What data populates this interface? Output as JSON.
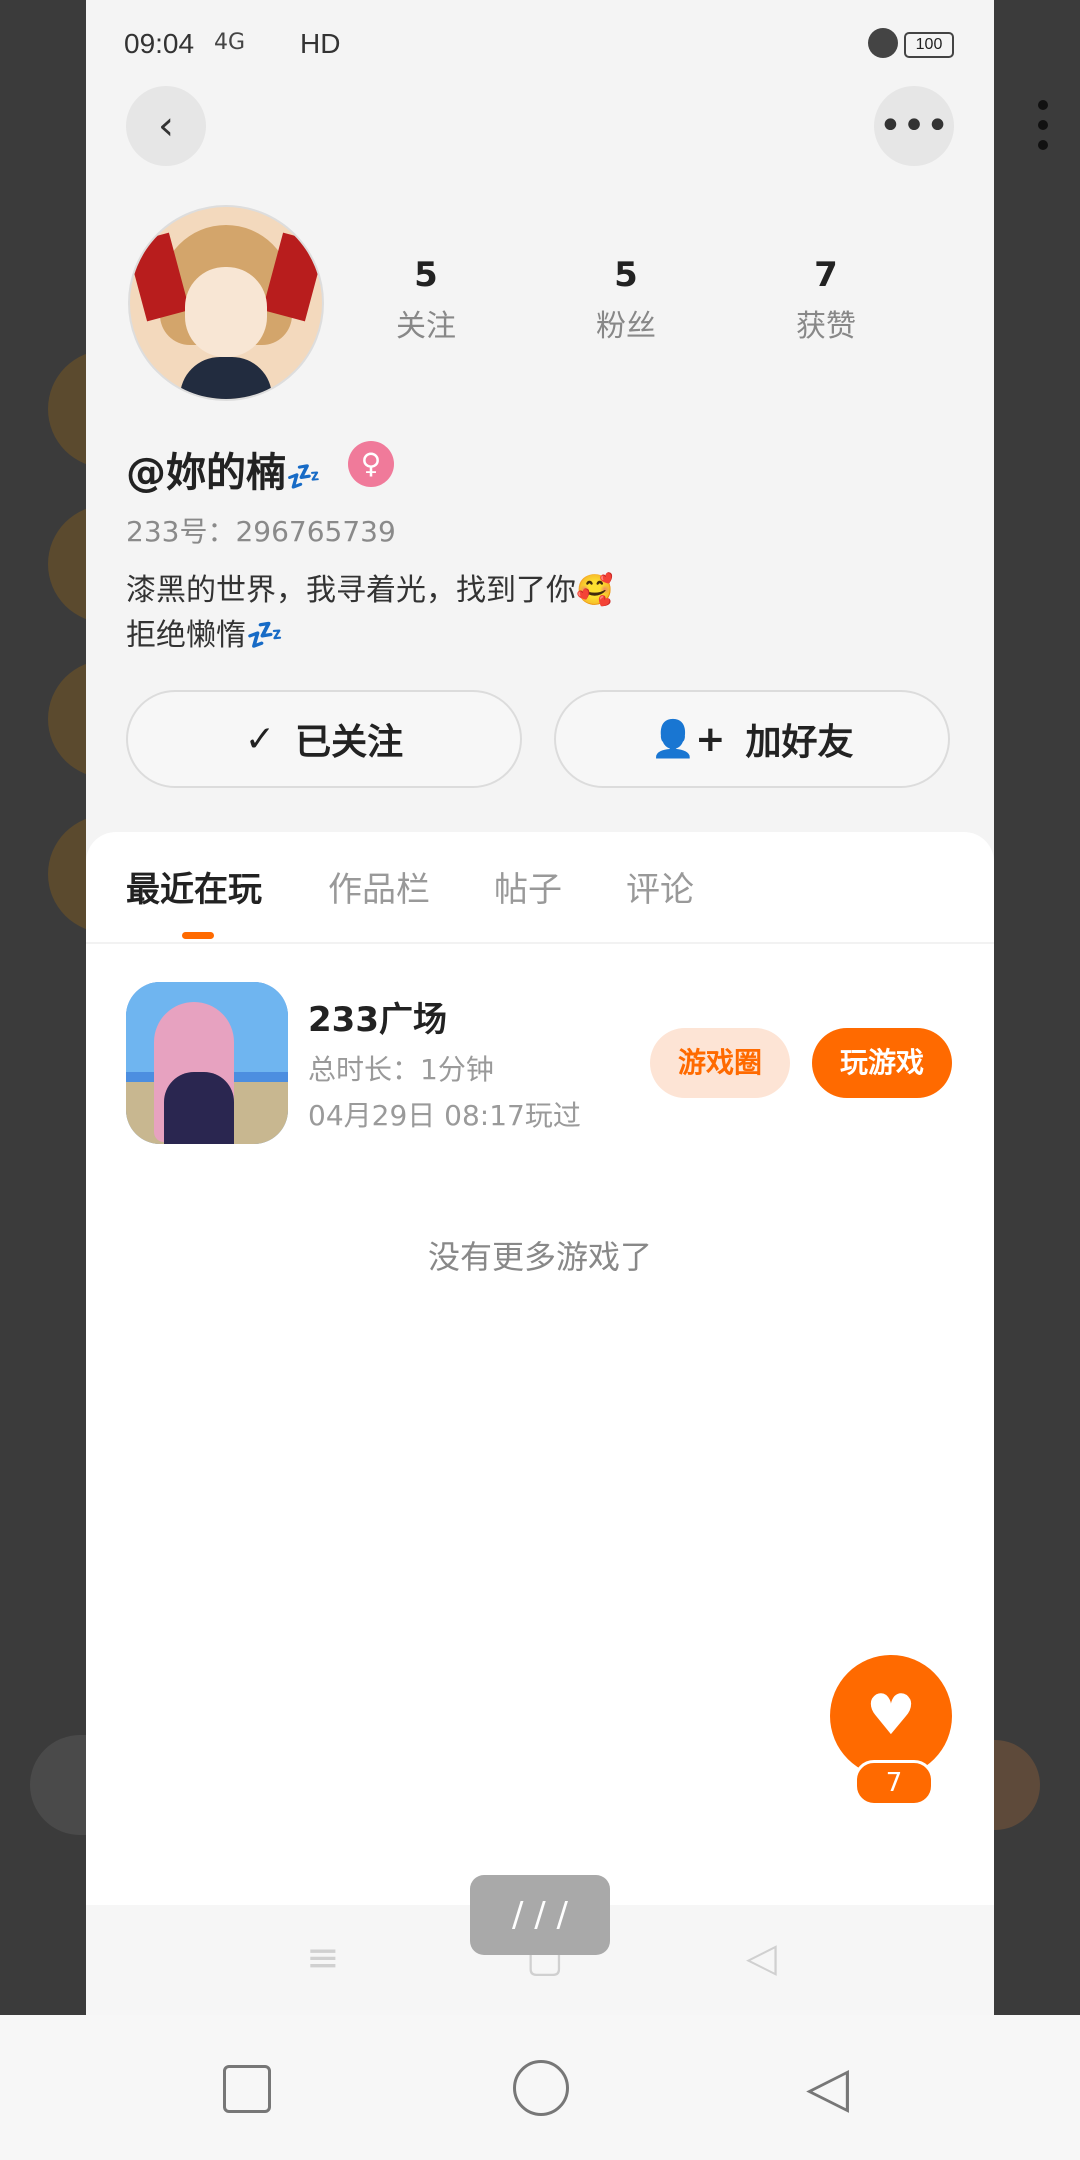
{
  "status_bar": {
    "time": "09:04",
    "network": "4G",
    "hd": "HD",
    "battery": "100"
  },
  "header": {
    "back_icon": "chevron-left-icon",
    "more_icon": "more-horizontal-icon"
  },
  "profile": {
    "stats": [
      {
        "value": "5",
        "label": "关注"
      },
      {
        "value": "5",
        "label": "粉丝"
      },
      {
        "value": "7",
        "label": "获赞"
      }
    ],
    "nickname": "@妳的楠",
    "nickname_emoji": "💤",
    "gender_symbol": "♀",
    "uid": "233号：296765739",
    "bio_line1": "漆黑的世界，我寻着光，找到了你🥰",
    "bio_line2": "拒绝懒惰💤"
  },
  "actions": {
    "follow_icon": "✓",
    "follow_label": "已关注",
    "add_friend_icon": "👤+",
    "add_friend_label": "加好友"
  },
  "tabs": [
    {
      "label": "最近在玩",
      "active": true
    },
    {
      "label": "作品栏",
      "active": false
    },
    {
      "label": "帖子",
      "active": false
    },
    {
      "label": "评论",
      "active": false
    }
  ],
  "games": [
    {
      "title": "233广场",
      "duration": "总时长：1分钟",
      "last_played": "04月29日 08:17玩过",
      "circle_label": "游戏圈",
      "play_label": "玩游戏"
    }
  ],
  "empty_message": "没有更多游戏了",
  "like": {
    "icon": "♥",
    "count": "7"
  },
  "page_indicator": "/ / /",
  "colors": {
    "accent": "#ff6a00",
    "accent_light": "#fde4d5",
    "gender_pink": "#f07a9a"
  }
}
